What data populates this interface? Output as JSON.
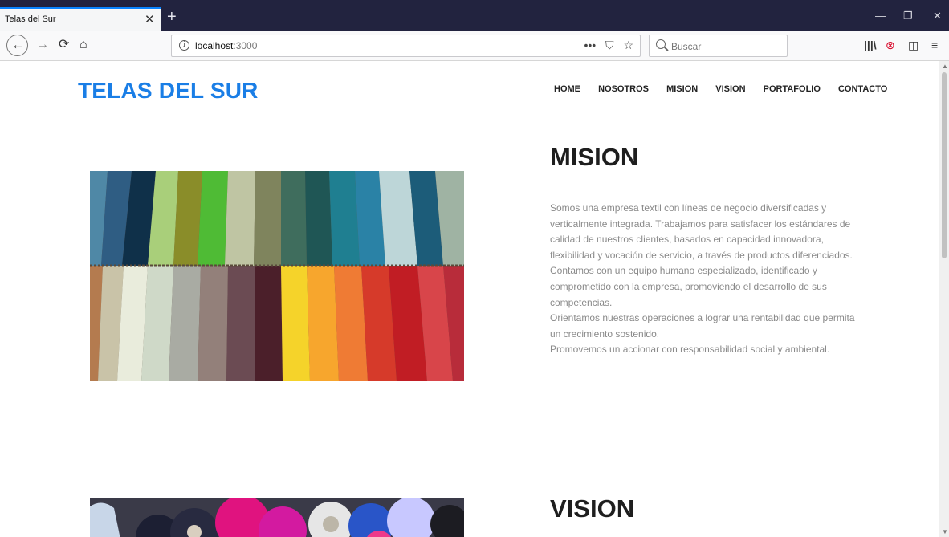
{
  "browser": {
    "tab_title": "Telas del Sur",
    "tab_close": "✕",
    "new_tab": "+",
    "url_host": "localhost",
    "url_port": ":3000",
    "search_placeholder": "Buscar",
    "url_actions": [
      "•••",
      "⛉",
      "☆"
    ],
    "minimize": "—",
    "restore": "❐",
    "close": "✕"
  },
  "site": {
    "brand": "TELAS DEL SUR",
    "menu": [
      "HOME",
      "NOSOTROS",
      "MISION",
      "VISION",
      "PORTAFOLIO",
      "CONTACTO"
    ],
    "mision": {
      "title": "MISION",
      "paragraphs": [
        "Somos una empresa textil con líneas de negocio diversificadas y verticalmente integrada. Trabajamos para satisfacer los estándares de calidad de nuestros clientes, basados en capacidad innovadora, flexibilidad y vocación de servicio, a través de productos diferenciados.",
        "Contamos con un equipo humano especializado, identificado y comprometido con la empresa, promoviendo el desarrollo de sus competencias.",
        "Orientamos nuestras operaciones a lograr una rentabilidad que permita un crecimiento sostenido.",
        "Promovemos un accionar con responsabilidad social y ambiental."
      ]
    },
    "vision": {
      "title": "VISION"
    }
  },
  "colors": {
    "brand": "#1a7ee6",
    "title": "#1e1e1e",
    "body_text": "#8a8a8a",
    "tabbar": "#22233f"
  }
}
